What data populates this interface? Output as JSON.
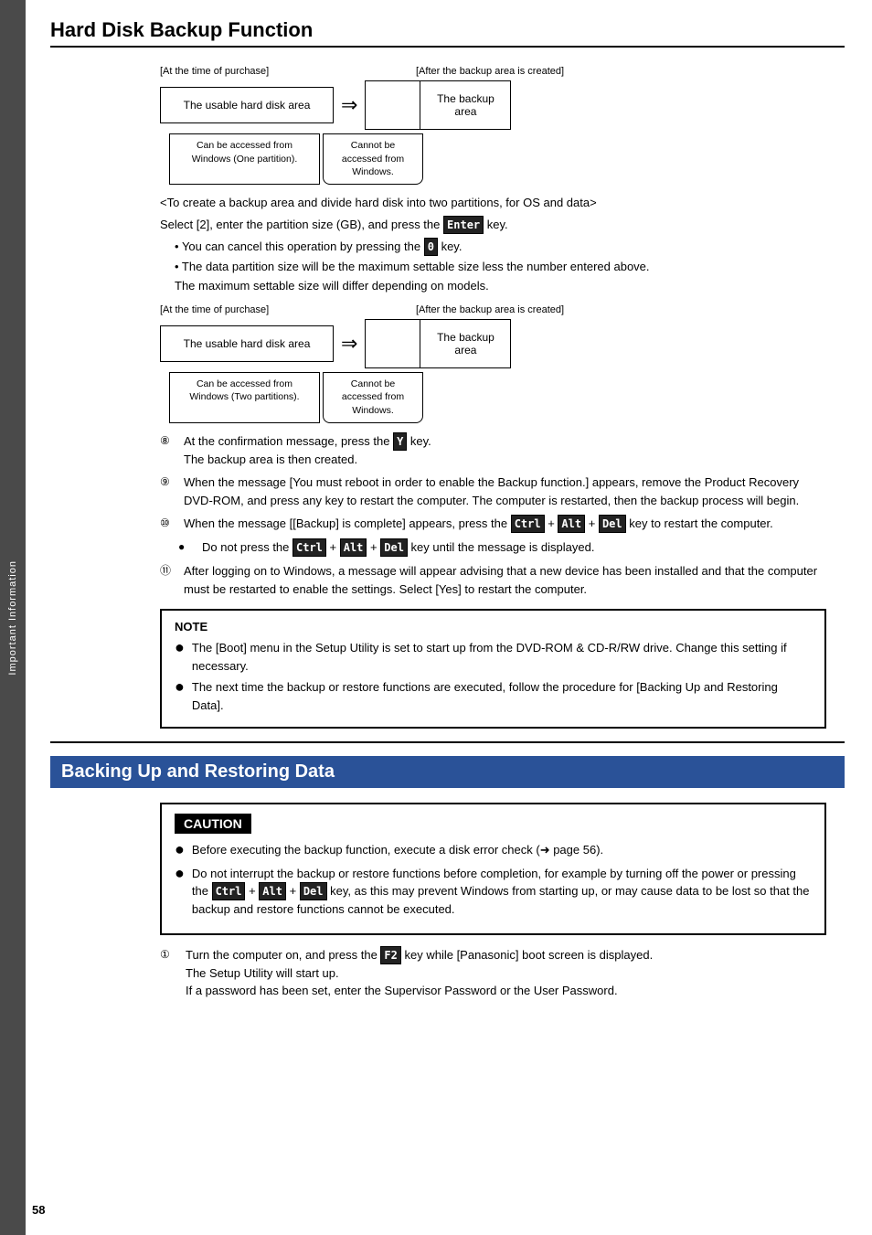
{
  "sidebar": {
    "label": "Important Information"
  },
  "page_number": "58",
  "section1": {
    "title": "Hard Disk Backup Function"
  },
  "section2": {
    "title": "Backing Up and Restoring Data"
  },
  "diagram1": {
    "label_left": "[At the time of purchase]",
    "label_right": "[After the backup area is created]",
    "usable_area": "The usable hard disk area",
    "backup_area": "The backup area",
    "access_main": "Can be accessed from Windows (One partition).",
    "access_no": "Cannot be accessed from Windows."
  },
  "diagram2": {
    "label_left": "[At the time of purchase]",
    "label_right": "[After the backup area is created]",
    "usable_area": "The usable hard disk area",
    "backup_area": "The backup area",
    "access_main": "Can be accessed from Windows (Two partitions).",
    "access_no": "Cannot be accessed from Windows."
  },
  "text1": {
    "intro": "<To create a backup area and divide hard disk into two partitions, for OS and data>",
    "select": "Select [2], enter the partition size (GB), and press the",
    "enter_key": "Enter",
    "select_suffix": "key.",
    "bullet1": "You can cancel this operation by pressing the",
    "bullet1_key": "0",
    "bullet1_suffix": "key.",
    "bullet2": "The data partition size will be the maximum settable size less the number entered above.",
    "bullet3": "The maximum settable size will differ depending on models."
  },
  "numbered_items": [
    {
      "num": "⑧",
      "text": "At the confirmation message, press the Y key. The backup area is then created."
    },
    {
      "num": "⑨",
      "text": "When the message [You must reboot in order to enable the Backup function.] appears, remove the Product Recovery DVD-ROM, and press any key to restart the computer. The computer is restarted, then the backup process will begin."
    },
    {
      "num": "⑩",
      "text": "When the message [[Backup] is complete] appears, press the Ctrl + Alt + Del key to restart the computer."
    },
    {
      "num_sub": "●",
      "text": "Do not press the Ctrl + Alt + Del key until the message is displayed."
    },
    {
      "num": "⑪",
      "text": "After logging on to Windows, a message will appear advising that a new device has been installed and that the computer must be restarted to enable the settings.  Select [Yes] to restart the computer."
    }
  ],
  "note": {
    "title": "NOTE",
    "items": [
      "The [Boot] menu in the Setup Utility is set to start up from the DVD-ROM & CD-R/RW drive. Change this setting if necessary.",
      "The next time the backup or restore functions are executed, follow the procedure for [Backing Up and Restoring Data]."
    ]
  },
  "caution": {
    "title": "CAUTION",
    "items": [
      "Before executing the backup function, execute a disk error check (➜ page 56).",
      "Do not interrupt the backup or restore functions before completion, for example by turning off the power or pressing the Ctrl + Alt + Del key, as this may prevent Windows from starting up, or may cause data to be lost so that the backup and restore functions cannot be executed."
    ]
  },
  "step1": {
    "num": "①",
    "text_before": "Turn the computer on, and press the",
    "key": "F2",
    "text_after": "key while [Panasonic] boot screen is displayed.",
    "line2": "The Setup Utility will start up.",
    "line3": "If a password has been set, enter the Supervisor Password or the User Password."
  }
}
